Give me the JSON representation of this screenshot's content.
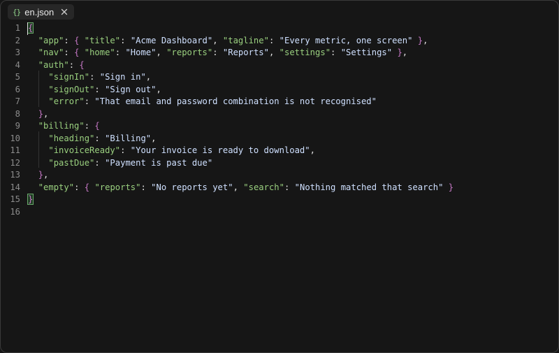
{
  "tab": {
    "title": "en.json",
    "icon": "json-braces-icon",
    "icon_text": "{}"
  },
  "line_numbers": [
    "1",
    "2",
    "3",
    "4",
    "5",
    "6",
    "7",
    "8",
    "9",
    "10",
    "11",
    "12",
    "13",
    "14",
    "15",
    "16"
  ],
  "code_lines": [
    [
      [
        "b",
        "{"
      ]
    ],
    [
      [
        "p",
        "  "
      ],
      [
        "k",
        "\"app\""
      ],
      [
        "p",
        ": "
      ],
      [
        "b",
        "{"
      ],
      [
        "p",
        " "
      ],
      [
        "k",
        "\"title\""
      ],
      [
        "p",
        ": "
      ],
      [
        "s",
        "\"Acme Dashboard\""
      ],
      [
        "p",
        ", "
      ],
      [
        "k",
        "\"tagline\""
      ],
      [
        "p",
        ": "
      ],
      [
        "s",
        "\"Every metric, one screen\""
      ],
      [
        "p",
        " "
      ],
      [
        "b",
        "}"
      ],
      [
        "p",
        ","
      ]
    ],
    [
      [
        "p",
        "  "
      ],
      [
        "k",
        "\"nav\""
      ],
      [
        "p",
        ": "
      ],
      [
        "b",
        "{"
      ],
      [
        "p",
        " "
      ],
      [
        "k",
        "\"home\""
      ],
      [
        "p",
        ": "
      ],
      [
        "s",
        "\"Home\""
      ],
      [
        "p",
        ", "
      ],
      [
        "k",
        "\"reports\""
      ],
      [
        "p",
        ": "
      ],
      [
        "s",
        "\"Reports\""
      ],
      [
        "p",
        ", "
      ],
      [
        "k",
        "\"settings\""
      ],
      [
        "p",
        ": "
      ],
      [
        "s",
        "\"Settings\""
      ],
      [
        "p",
        " "
      ],
      [
        "b",
        "}"
      ],
      [
        "p",
        ","
      ]
    ],
    [
      [
        "p",
        "  "
      ],
      [
        "k",
        "\"auth\""
      ],
      [
        "p",
        ": "
      ],
      [
        "b",
        "{"
      ]
    ],
    [
      [
        "p",
        "    "
      ],
      [
        "k",
        "\"signIn\""
      ],
      [
        "p",
        ": "
      ],
      [
        "s",
        "\"Sign in\""
      ],
      [
        "p",
        ","
      ]
    ],
    [
      [
        "p",
        "    "
      ],
      [
        "k",
        "\"signOut\""
      ],
      [
        "p",
        ": "
      ],
      [
        "s",
        "\"Sign out\""
      ],
      [
        "p",
        ","
      ]
    ],
    [
      [
        "p",
        "    "
      ],
      [
        "k",
        "\"error\""
      ],
      [
        "p",
        ": "
      ],
      [
        "s",
        "\"That email and password combination is not recognised\""
      ]
    ],
    [
      [
        "p",
        "  "
      ],
      [
        "b",
        "}"
      ],
      [
        "p",
        ","
      ]
    ],
    [
      [
        "p",
        "  "
      ],
      [
        "k",
        "\"billing\""
      ],
      [
        "p",
        ": "
      ],
      [
        "b",
        "{"
      ]
    ],
    [
      [
        "p",
        "    "
      ],
      [
        "k",
        "\"heading\""
      ],
      [
        "p",
        ": "
      ],
      [
        "s",
        "\"Billing\""
      ],
      [
        "p",
        ","
      ]
    ],
    [
      [
        "p",
        "    "
      ],
      [
        "k",
        "\"invoiceReady\""
      ],
      [
        "p",
        ": "
      ],
      [
        "s",
        "\"Your invoice is ready to download\""
      ],
      [
        "p",
        ","
      ]
    ],
    [
      [
        "p",
        "    "
      ],
      [
        "k",
        "\"pastDue\""
      ],
      [
        "p",
        ": "
      ],
      [
        "s",
        "\"Payment is past due\""
      ]
    ],
    [
      [
        "p",
        "  "
      ],
      [
        "b",
        "}"
      ],
      [
        "p",
        ","
      ]
    ],
    [
      [
        "p",
        "  "
      ],
      [
        "k",
        "\"empty\""
      ],
      [
        "p",
        ": "
      ],
      [
        "b",
        "{"
      ],
      [
        "p",
        " "
      ],
      [
        "k",
        "\"reports\""
      ],
      [
        "p",
        ": "
      ],
      [
        "s",
        "\"No reports yet\""
      ],
      [
        "p",
        ", "
      ],
      [
        "k",
        "\"search\""
      ],
      [
        "p",
        ": "
      ],
      [
        "s",
        "\"Nothing matched that search\""
      ],
      [
        "p",
        " "
      ],
      [
        "b",
        "}"
      ]
    ],
    [
      [
        "b",
        "}"
      ]
    ],
    []
  ],
  "colors": {
    "key": "#9ad07f",
    "string": "#cfe0ff",
    "bracket": "#c678c6",
    "background": "#161616"
  }
}
